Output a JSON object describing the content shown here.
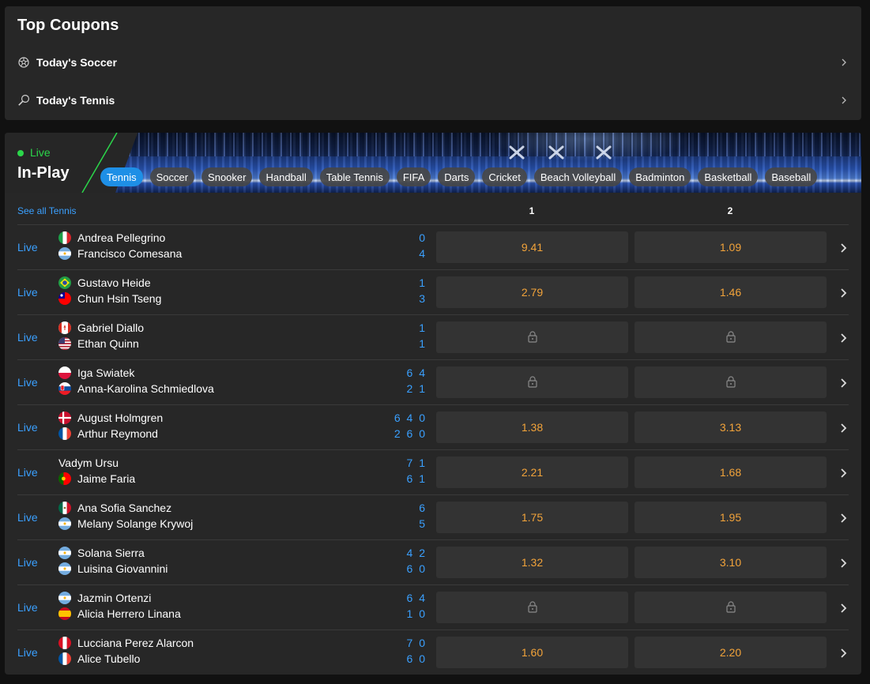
{
  "coupons": {
    "title": "Top Coupons",
    "items": [
      {
        "label": "Today's Soccer",
        "icon": "soccer-ball-icon"
      },
      {
        "label": "Today's Tennis",
        "icon": "tennis-racket-icon"
      }
    ]
  },
  "inplay": {
    "live_label": "Live",
    "title": "In-Play",
    "sports": [
      {
        "label": "Tennis",
        "active": true
      },
      {
        "label": "Soccer"
      },
      {
        "label": "Snooker"
      },
      {
        "label": "Handball"
      },
      {
        "label": "Table Tennis"
      },
      {
        "label": "FIFA"
      },
      {
        "label": "Darts"
      },
      {
        "label": "Cricket"
      },
      {
        "label": "Beach Volleyball"
      },
      {
        "label": "Badminton"
      },
      {
        "label": "Basketball"
      },
      {
        "label": "Baseball"
      }
    ],
    "see_all": "See all Tennis",
    "col1": "1",
    "col2": "2",
    "matches": [
      {
        "status": "Live",
        "p1": "Andrea Pellegrino",
        "f1": "it",
        "p2": "Francisco Comesana",
        "f2": "ar",
        "s1": "0",
        "s2": "4",
        "o1": "9.41",
        "o2": "1.09"
      },
      {
        "status": "Live",
        "p1": "Gustavo Heide",
        "f1": "br",
        "p2": "Chun Hsin Tseng",
        "f2": "tw",
        "s1": "1",
        "s2": "3",
        "o1": "2.79",
        "o2": "1.46"
      },
      {
        "status": "Live",
        "p1": "Gabriel Diallo",
        "f1": "ca",
        "p2": "Ethan Quinn",
        "f2": "us",
        "s1": "1",
        "s2": "1",
        "o1": "",
        "o2": ""
      },
      {
        "status": "Live",
        "p1": "Iga Swiatek",
        "f1": "pl",
        "p2": "Anna-Karolina Schmiedlova",
        "f2": "sk",
        "s1": "6 4",
        "s2": "2 1",
        "o1": "",
        "o2": ""
      },
      {
        "status": "Live",
        "p1": "August Holmgren",
        "f1": "dk",
        "p2": "Arthur Reymond",
        "f2": "fr",
        "s1": "6 4 0",
        "s2": "2 6 0",
        "o1": "1.38",
        "o2": "3.13"
      },
      {
        "status": "Live",
        "p1": "Vadym Ursu",
        "f1": "",
        "p2": "Jaime Faria",
        "f2": "pt",
        "s1": "7 1",
        "s2": "6 1",
        "o1": "2.21",
        "o2": "1.68"
      },
      {
        "status": "Live",
        "p1": "Ana Sofia Sanchez",
        "f1": "mx",
        "p2": "Melany Solange Krywoj",
        "f2": "ar",
        "s1": "6",
        "s2": "5",
        "o1": "1.75",
        "o2": "1.95"
      },
      {
        "status": "Live",
        "p1": "Solana Sierra",
        "f1": "ar",
        "p2": "Luisina Giovannini",
        "f2": "ar",
        "s1": "4 2",
        "s2": "6 0",
        "o1": "1.32",
        "o2": "3.10"
      },
      {
        "status": "Live",
        "p1": "Jazmin Ortenzi",
        "f1": "ar",
        "p2": "Alicia Herrero Linana",
        "f2": "es",
        "s1": "6 4",
        "s2": "1 0",
        "o1": "",
        "o2": ""
      },
      {
        "status": "Live",
        "p1": "Lucciana Perez Alarcon",
        "f1": "pe",
        "p2": "Alice Tubello",
        "f2": "fr",
        "s1": "7 0",
        "s2": "6 0",
        "o1": "1.60",
        "o2": "2.20"
      }
    ]
  },
  "colors": {
    "panel": "#272727",
    "accent_blue": "#3aa0ff",
    "live_green": "#2bd64a",
    "odds_orange": "#f2a33a",
    "chip_active": "#1e8fe6"
  }
}
